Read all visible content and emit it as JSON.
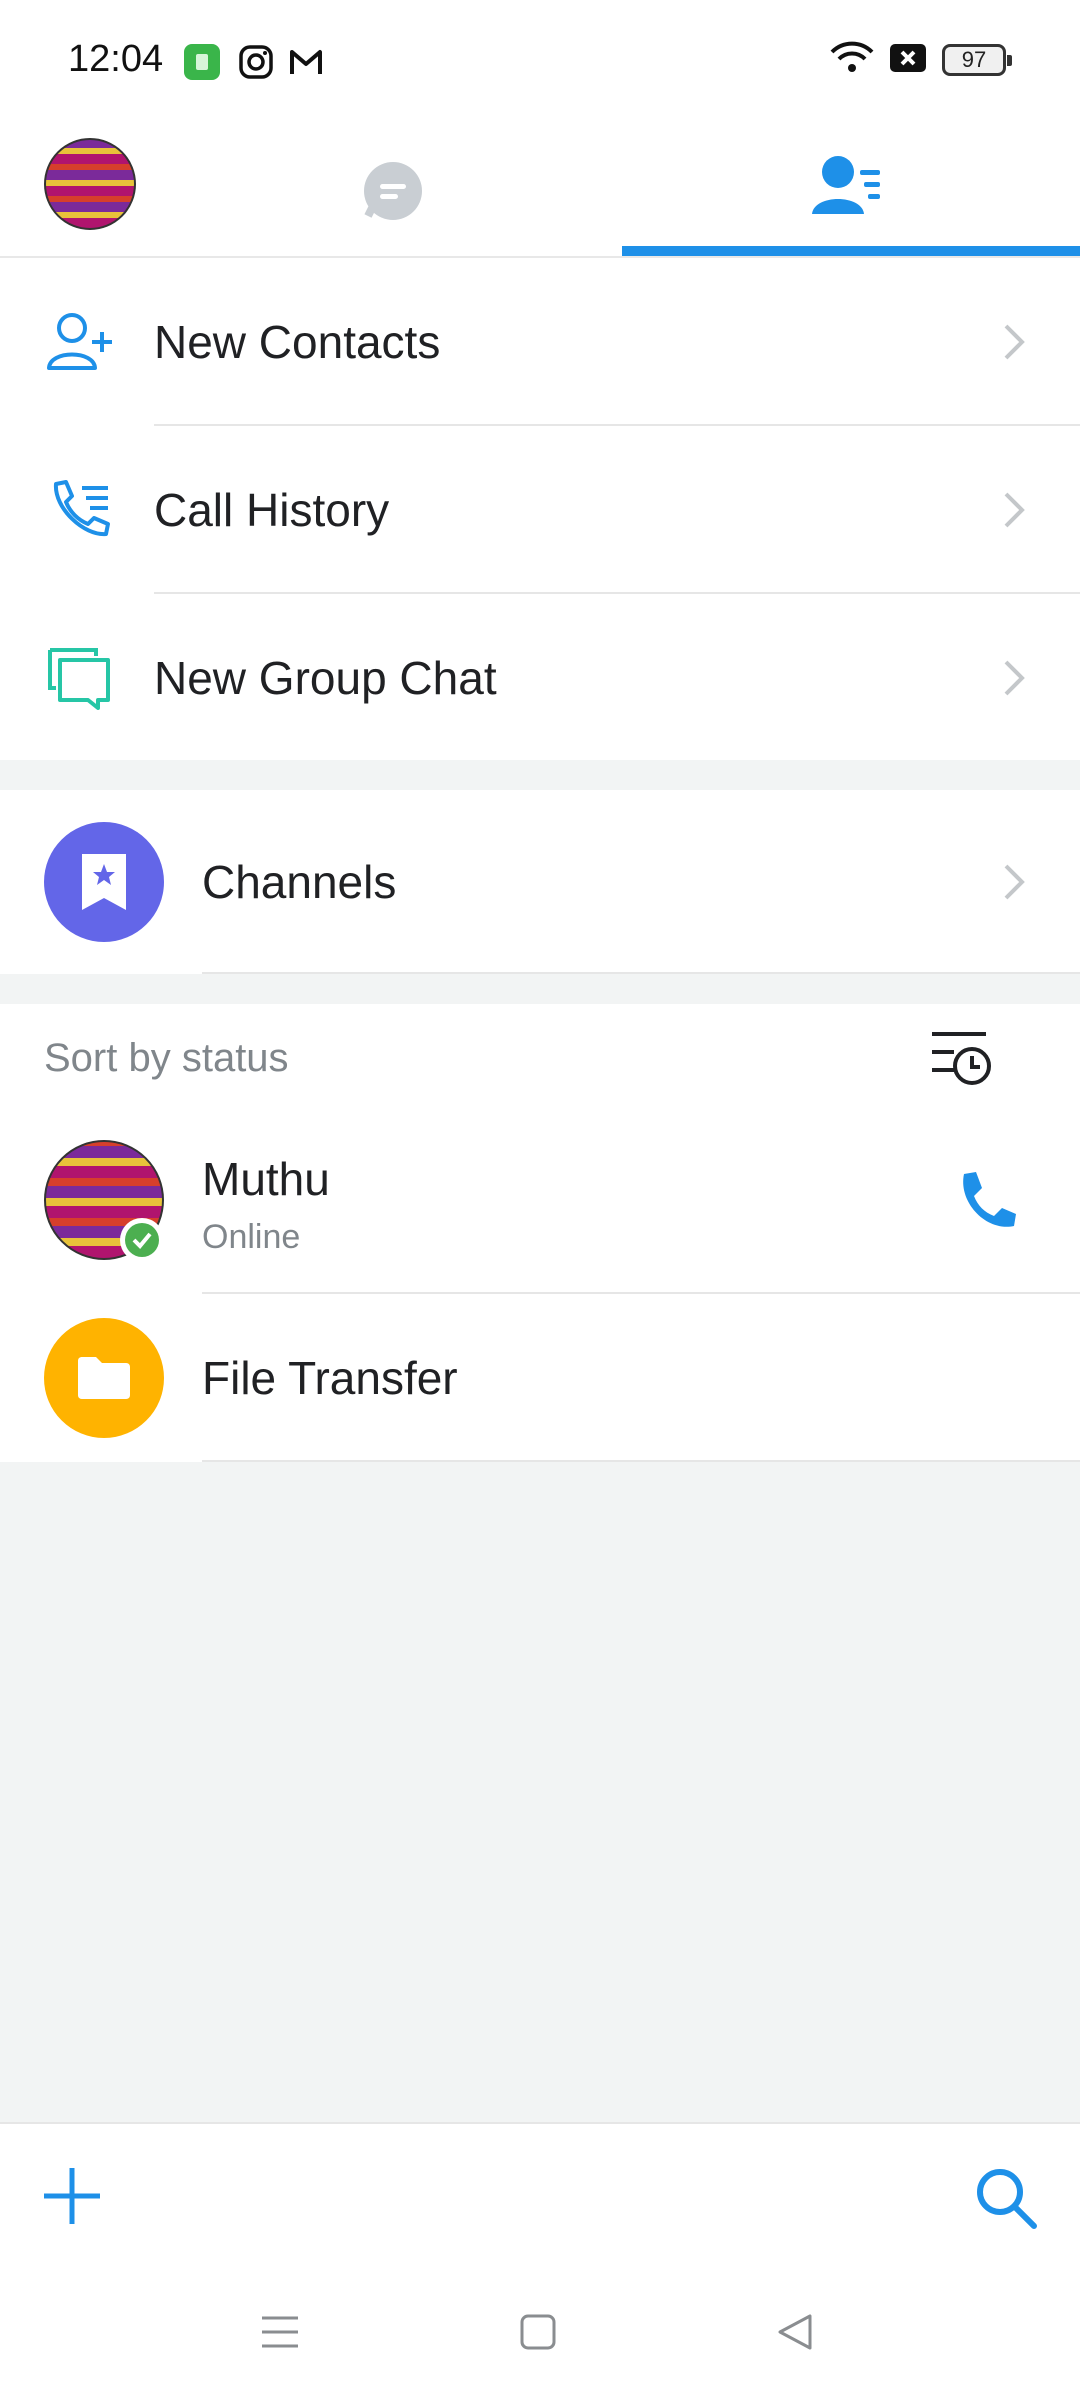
{
  "status_bar": {
    "time": "12:04",
    "battery": "97",
    "app_icons": [
      "android-app-icon",
      "instagram-icon",
      "gmail-icon"
    ],
    "system_icons": [
      "wifi-icon",
      "no-sim-icon",
      "battery-icon"
    ]
  },
  "tabs": [
    {
      "name": "profile-avatar"
    },
    {
      "name": "chats-tab-icon"
    },
    {
      "name": "contacts-tab-icon",
      "active": true
    }
  ],
  "menu": {
    "items": [
      {
        "label": "New Contacts",
        "icon": "add-contact-icon"
      },
      {
        "label": "Call History",
        "icon": "call-history-icon"
      },
      {
        "label": "New Group Chat",
        "icon": "group-chat-icon"
      }
    ],
    "channels": {
      "label": "Channels",
      "icon": "bookmark-star-icon"
    }
  },
  "contacts": {
    "sort_label": "Sort by status",
    "list": [
      {
        "name": "Muthu",
        "status": "Online"
      }
    ],
    "file_transfer": {
      "label": "File Transfer",
      "icon": "folder-icon"
    }
  },
  "colors": {
    "accent": "#1e90e8",
    "channels": "#6366e8",
    "file_transfer": "#ffb300",
    "group_chat": "#26c6a6",
    "online": "#4caf50"
  }
}
